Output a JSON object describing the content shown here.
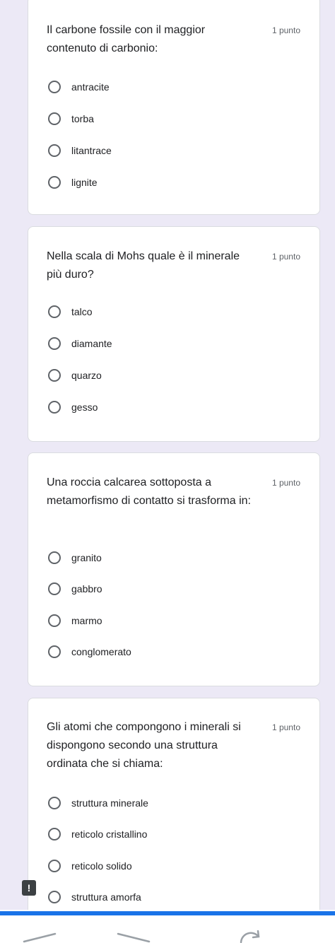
{
  "questions": [
    {
      "text": "Il carbone fossile con il maggior contenuto di carbonio:",
      "points": "1 punto",
      "options": [
        "antracite",
        "torba",
        "litantrace",
        "lignite"
      ]
    },
    {
      "text": "Nella scala di Mohs quale è il minerale più duro?",
      "points": "1 punto",
      "options": [
        "talco",
        "diamante",
        "quarzo",
        "gesso"
      ]
    },
    {
      "text": "Una roccia calcarea sottoposta a metamorfismo di contatto si trasforma in:",
      "points": "1 punto",
      "options": [
        "granito",
        "gabbro",
        "marmo",
        "conglomerato"
      ]
    },
    {
      "text": "Gli atomi che compongono i minerali si dispongono secondo una struttura ordinata che si chiama:",
      "points": "1 punto",
      "options": [
        "struttura minerale",
        "reticolo cristallino",
        "reticolo solido",
        "struttura amorfa"
      ]
    }
  ],
  "report_button": {
    "icon": "exclamation-icon",
    "glyph": "!"
  },
  "colors": {
    "background": "#ece9f6",
    "card": "#ffffff",
    "accent_bar": "#1a73e8",
    "radio_border": "#5f6368"
  }
}
